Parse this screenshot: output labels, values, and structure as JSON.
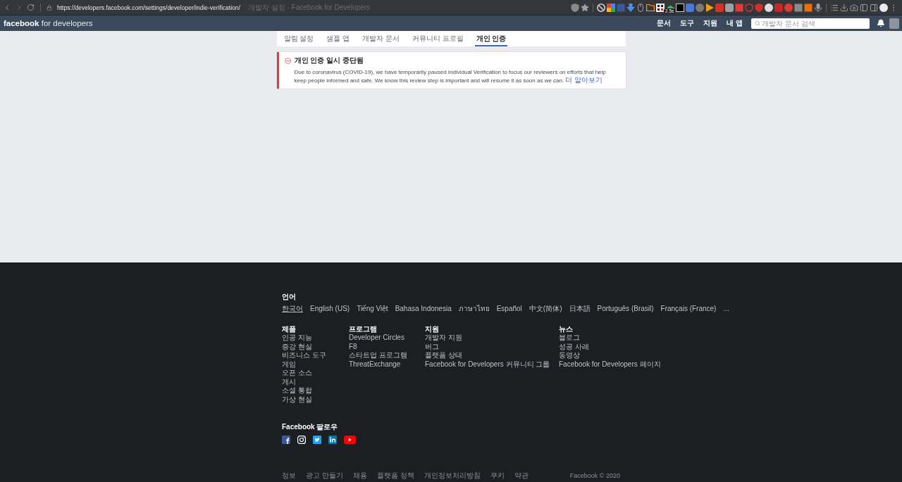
{
  "browser": {
    "url": "https://developers.facebook.com/settings/developer/indie-verification/",
    "page_title": "개발자 설정 - Facebook for Developers",
    "extension_badge": "2.5s"
  },
  "navbar": {
    "logo": "**facebook** for developers",
    "links": [
      "문서",
      "도구",
      "지원",
      "내 앱"
    ],
    "search": {
      "placeholder": "개발자 문서 검색"
    }
  },
  "tabs": [
    {
      "label": "알림 설정",
      "selected": false
    },
    {
      "label": "샘플 앱",
      "selected": false
    },
    {
      "label": "개발자 문서",
      "selected": false
    },
    {
      "label": "커뮤니티 프로필",
      "selected": false
    },
    {
      "label": "개인 인증",
      "selected": true
    }
  ],
  "alert": {
    "title": "개인 인증 일시 중단됨",
    "message": "Due to coronavirus (COVID-19), we have temporarily paused Individual Verification to focus our reviewers on efforts that help keep people informed and safe. We know this review step is important and will resume it as soon as we can.",
    "link": "더 알아보기"
  },
  "footer": {
    "language_heading": "언어",
    "languages": [
      {
        "label": "한국어",
        "selected": true
      },
      {
        "label": "English (US)",
        "selected": false
      },
      {
        "label": "Tiếng Việt",
        "selected": false
      },
      {
        "label": "Bahasa Indonesia",
        "selected": false
      },
      {
        "label": "ภาษาไทย",
        "selected": false
      },
      {
        "label": "Español",
        "selected": false
      },
      {
        "label": "中文(简体)",
        "selected": false
      },
      {
        "label": "日本語",
        "selected": false
      },
      {
        "label": "Português (Brasil)",
        "selected": false
      },
      {
        "label": "Français (France)",
        "selected": false
      }
    ],
    "more_languages": "...",
    "columns": [
      {
        "heading": "제품",
        "items": [
          "인공 지능",
          "증강 현실",
          "비즈니스 도구",
          "게임",
          "오픈 소스",
          "게시",
          "소셜 통합",
          "가상 현실"
        ]
      },
      {
        "heading": "프로그램",
        "items": [
          "Developer Circles",
          "F8",
          "스타트업 프로그램",
          "ThreatExchange"
        ]
      },
      {
        "heading": "지원",
        "items": [
          "개발자 지원",
          "버그",
          "플랫폼 상태",
          "Facebook for Developers 커뮤니티 그룹"
        ]
      },
      {
        "heading": "뉴스",
        "items": [
          "블로그",
          "성공 사례",
          "동영상",
          "Facebook for Developers 페이지"
        ]
      }
    ],
    "follow_heading": "Facebook 팔로우",
    "bottom_links": [
      "정보",
      "광고 만들기",
      "채용",
      "플랫폼 정책",
      "개인정보처리방침",
      "쿠키",
      "약관"
    ],
    "copyright": "Facebook © 2020"
  }
}
